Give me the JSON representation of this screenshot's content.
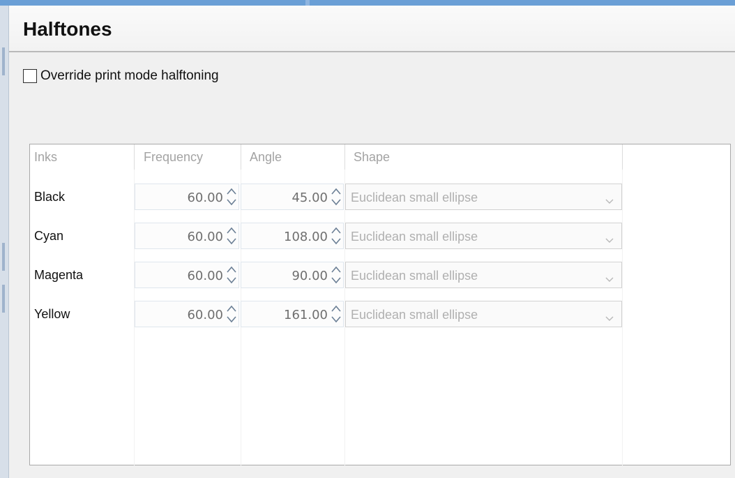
{
  "panel": {
    "title": "Halftones",
    "override_label": "Override print mode halftoning",
    "override_checked": false
  },
  "grid": {
    "columns": [
      "Inks",
      "Frequency",
      "Angle",
      "Shape"
    ],
    "rows": [
      {
        "ink": "Black",
        "frequency": "60.00",
        "angle": "45.00",
        "shape": "Euclidean small ellipse"
      },
      {
        "ink": "Cyan",
        "frequency": "60.00",
        "angle": "108.00",
        "shape": "Euclidean small ellipse"
      },
      {
        "ink": "Magenta",
        "frequency": "60.00",
        "angle": "90.00",
        "shape": "Euclidean small ellipse"
      },
      {
        "ink": "Yellow",
        "frequency": "60.00",
        "angle": "161.00",
        "shape": "Euclidean small ellipse"
      }
    ]
  },
  "icons": {
    "spinner": "up-down-arrows-icon",
    "dropdown": "chevron-down-icon"
  },
  "colors": {
    "accent": "#6a9fd6",
    "disabled_text": "#a3a3a3"
  }
}
